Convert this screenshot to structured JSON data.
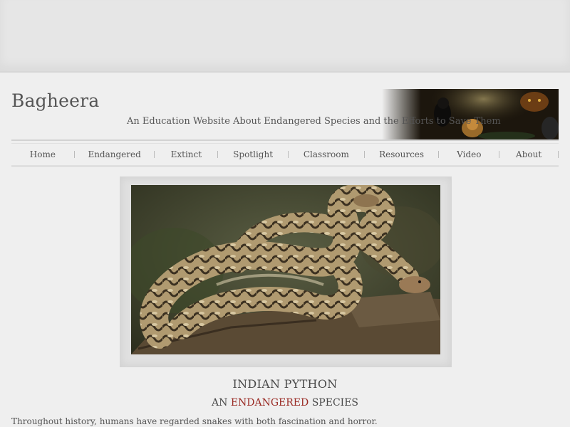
{
  "site": {
    "title": "Bagheera",
    "tagline": "An Education Website About Endangered Species and the Efforts to Save Them"
  },
  "nav": {
    "items": [
      {
        "label": "Home"
      },
      {
        "label": "Endangered"
      },
      {
        "label": "Extinct"
      },
      {
        "label": "Spotlight"
      },
      {
        "label": "Classroom"
      },
      {
        "label": "Resources"
      },
      {
        "label": "Video"
      },
      {
        "label": "About"
      }
    ]
  },
  "article": {
    "title": "INDIAN PYTHON",
    "subtitle_prefix": "AN",
    "subtitle_highlight": "ENDANGERED",
    "subtitle_suffix": "SPECIES",
    "intro": "Throughout history, humans have regarded snakes with both fascination and horror."
  },
  "colors": {
    "accent_red": "#9a2b25",
    "text": "#4a4a4a",
    "background": "#efefef"
  },
  "icons": {
    "hero": "python-photo",
    "banner": "wildlife-banner"
  }
}
